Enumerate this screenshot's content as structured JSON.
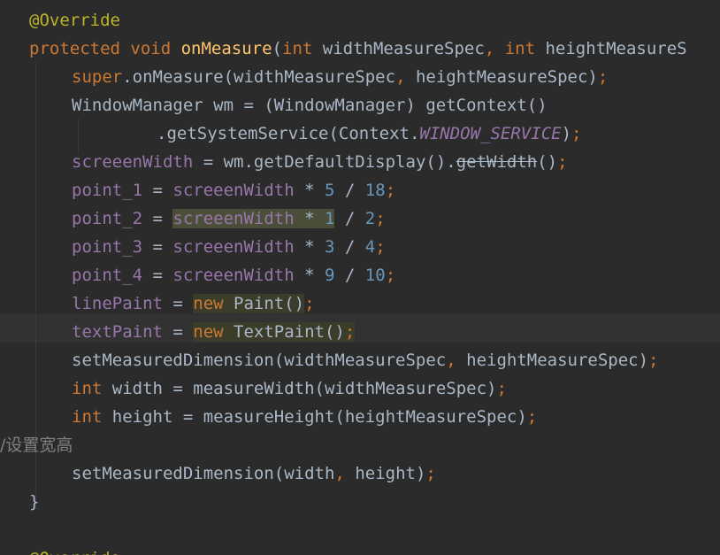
{
  "editor": {
    "lines": [
      {
        "indent": 1,
        "tokens": [
          {
            "t": "@Override",
            "c": "ann"
          }
        ]
      },
      {
        "indent": 1,
        "tokens": [
          {
            "t": "protected ",
            "c": "kw"
          },
          {
            "t": "void ",
            "c": "kw"
          },
          {
            "t": "onMeasure",
            "c": "fn"
          },
          {
            "t": "(",
            "c": ""
          },
          {
            "t": "int ",
            "c": "kw"
          },
          {
            "t": "widthMeasureSpec",
            "c": ""
          },
          {
            "t": ", ",
            "c": "kw"
          },
          {
            "t": "int ",
            "c": "kw"
          },
          {
            "t": "heightMeasureS",
            "c": ""
          }
        ]
      },
      {
        "indent": 2,
        "tokens": [
          {
            "t": "super",
            "c": "kw"
          },
          {
            "t": ".onMeasure(widthMeasureSpec",
            "c": ""
          },
          {
            "t": ", ",
            "c": "kw"
          },
          {
            "t": "heightMeasureSpec)",
            "c": ""
          },
          {
            "t": ";",
            "c": "kw"
          }
        ]
      },
      {
        "indent": 2,
        "tokens": [
          {
            "t": "WindowManager wm = (WindowManager) getContext()",
            "c": ""
          }
        ]
      },
      {
        "indent": 4,
        "tokens": [
          {
            "t": ".getSystemService(Context.",
            "c": ""
          },
          {
            "t": "WINDOW_SERVICE",
            "c": "ital"
          },
          {
            "t": ")",
            "c": ""
          },
          {
            "t": ";",
            "c": "kw"
          }
        ]
      },
      {
        "indent": 2,
        "tokens": [
          {
            "t": "screeenWidth",
            "c": "fld"
          },
          {
            "t": " = wm.getDefaultDisplay().",
            "c": ""
          },
          {
            "t": "getWidth",
            "c": "strike"
          },
          {
            "t": "()",
            "c": ""
          },
          {
            "t": ";",
            "c": "kw"
          }
        ]
      },
      {
        "indent": 2,
        "tokens": [
          {
            "t": "point_1",
            "c": "fld"
          },
          {
            "t": " = ",
            "c": ""
          },
          {
            "t": "screeenWidth",
            "c": "fld"
          },
          {
            "t": " * ",
            "c": ""
          },
          {
            "t": "5",
            "c": "num"
          },
          {
            "t": " / ",
            "c": ""
          },
          {
            "t": "18",
            "c": "num"
          },
          {
            "t": ";",
            "c": "kw"
          }
        ]
      },
      {
        "indent": 2,
        "tokens": [
          {
            "t": "point_2",
            "c": "fld"
          },
          {
            "t": " = ",
            "c": ""
          },
          {
            "t": "screeenWidth",
            "c": "fld hl-read"
          },
          {
            "t": " * ",
            "c": "hl-read"
          },
          {
            "t": "1",
            "c": "num hl-read"
          },
          {
            "t": " / ",
            "c": ""
          },
          {
            "t": "2",
            "c": "num"
          },
          {
            "t": ";",
            "c": "kw"
          }
        ]
      },
      {
        "indent": 2,
        "tokens": [
          {
            "t": "point_3",
            "c": "fld"
          },
          {
            "t": " = ",
            "c": ""
          },
          {
            "t": "screeenWidth",
            "c": "fld"
          },
          {
            "t": " * ",
            "c": ""
          },
          {
            "t": "3",
            "c": "num"
          },
          {
            "t": " / ",
            "c": ""
          },
          {
            "t": "4",
            "c": "num"
          },
          {
            "t": ";",
            "c": "kw"
          }
        ]
      },
      {
        "indent": 2,
        "tokens": [
          {
            "t": "point_4",
            "c": "fld"
          },
          {
            "t": " = ",
            "c": ""
          },
          {
            "t": "screeenWidth",
            "c": "fld"
          },
          {
            "t": " * ",
            "c": ""
          },
          {
            "t": "9",
            "c": "num"
          },
          {
            "t": " / ",
            "c": ""
          },
          {
            "t": "10",
            "c": "num"
          },
          {
            "t": ";",
            "c": "kw"
          }
        ]
      },
      {
        "indent": 2,
        "tokens": [
          {
            "t": "linePaint",
            "c": "fld"
          },
          {
            "t": " = ",
            "c": ""
          },
          {
            "t": "new ",
            "c": "kw hl-box"
          },
          {
            "t": "Paint()",
            "c": "hl-box"
          },
          {
            "t": ";",
            "c": "kw"
          }
        ]
      },
      {
        "indent": 2,
        "tokens": [
          {
            "t": "textPaint",
            "c": "fld"
          },
          {
            "t": " = ",
            "c": ""
          },
          {
            "t": "new ",
            "c": "kw hl-box"
          },
          {
            "t": "TextPaint()",
            "c": "hl-box"
          },
          {
            "t": ";",
            "c": "kw hl-box"
          }
        ]
      },
      {
        "indent": 2,
        "tokens": [
          {
            "t": "setMeasuredDimension(widthMeasureSpec",
            "c": ""
          },
          {
            "t": ", ",
            "c": "kw"
          },
          {
            "t": "heightMeasureSpec)",
            "c": ""
          },
          {
            "t": ";",
            "c": "kw"
          }
        ]
      },
      {
        "indent": 2,
        "tokens": [
          {
            "t": "int ",
            "c": "kw"
          },
          {
            "t": "width = measureWidth(widthMeasureSpec)",
            "c": ""
          },
          {
            "t": ";",
            "c": "kw"
          }
        ]
      },
      {
        "indent": 2,
        "tokens": [
          {
            "t": "int ",
            "c": "kw"
          },
          {
            "t": "height = measureHeight(heightMeasureSpec)",
            "c": ""
          },
          {
            "t": ";",
            "c": "kw"
          }
        ]
      },
      {
        "indent": 0,
        "tokens": [
          {
            "t": "/设置宽高",
            "c": "cmt"
          }
        ]
      },
      {
        "indent": 2,
        "tokens": [
          {
            "t": "setMeasuredDimension(width",
            "c": ""
          },
          {
            "t": ", ",
            "c": "kw"
          },
          {
            "t": "height)",
            "c": ""
          },
          {
            "t": ";",
            "c": "kw"
          }
        ]
      },
      {
        "indent": 1,
        "tokens": [
          {
            "t": "}",
            "c": ""
          }
        ]
      },
      {
        "indent": 0,
        "tokens": [
          {
            "t": "",
            "c": ""
          }
        ]
      },
      {
        "indent": 1,
        "tokens": [
          {
            "t": "@Override",
            "c": "ann"
          }
        ]
      }
    ]
  }
}
